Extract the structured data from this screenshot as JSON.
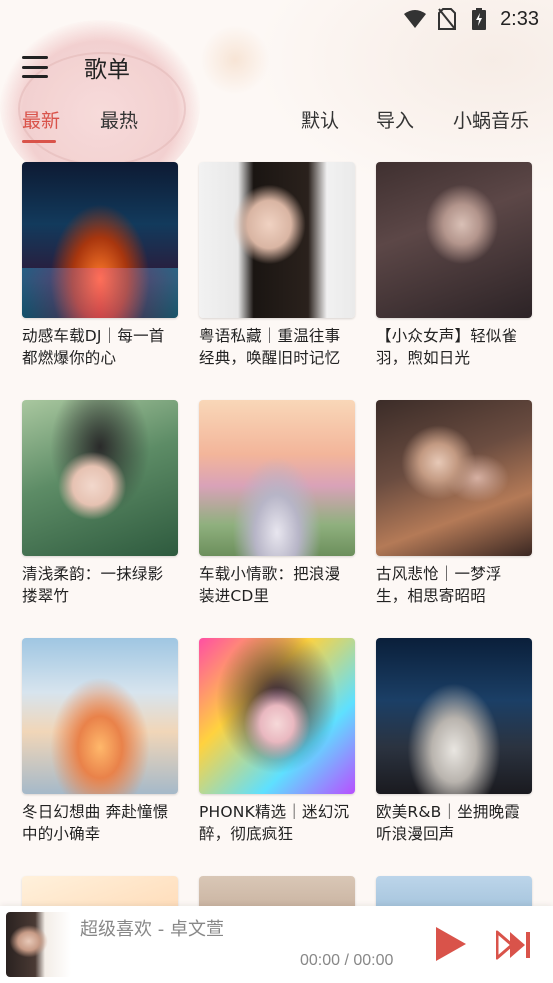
{
  "status_bar": {
    "time": "2:33",
    "icons": [
      "wifi-icon",
      "no-sim-icon",
      "battery-charging-icon"
    ]
  },
  "header": {
    "menu_icon": "menu-icon",
    "title": "歌单"
  },
  "tabs": [
    {
      "label": "最新",
      "active": true
    },
    {
      "label": "最热",
      "active": false
    },
    {
      "label": "默认",
      "active": false
    },
    {
      "label": "导入",
      "active": false
    },
    {
      "label": "小蜗音乐",
      "active": false
    }
  ],
  "accent_color": "#d9534a",
  "playlists": [
    {
      "title": "动感车载DJ｜每一首都燃爆你的心"
    },
    {
      "title": "粤语私藏｜重温往事经典，唤醒旧时记忆"
    },
    {
      "title": "【小众女声】轻似雀羽，煦如日光"
    },
    {
      "title": "清浅柔韵：一抹绿影搂翠竹"
    },
    {
      "title": "车载小情歌：把浪漫装进CD里"
    },
    {
      "title": "古风悲怆｜一梦浮生，相思寄昭昭"
    },
    {
      "title": "冬日幻想曲 奔赴憧憬中的小确幸"
    },
    {
      "title": "PHONK精选｜迷幻沉醉，彻底疯狂"
    },
    {
      "title": "欧美R&B｜坐拥晚霞听浪漫回声"
    },
    {
      "title": ""
    },
    {
      "title": ""
    },
    {
      "title": ""
    }
  ],
  "player": {
    "track": "超级喜欢 - 卓文萱",
    "time": "00:00 / 00:00",
    "play_icon": "play-icon",
    "next_icon": "skip-next-icon"
  }
}
